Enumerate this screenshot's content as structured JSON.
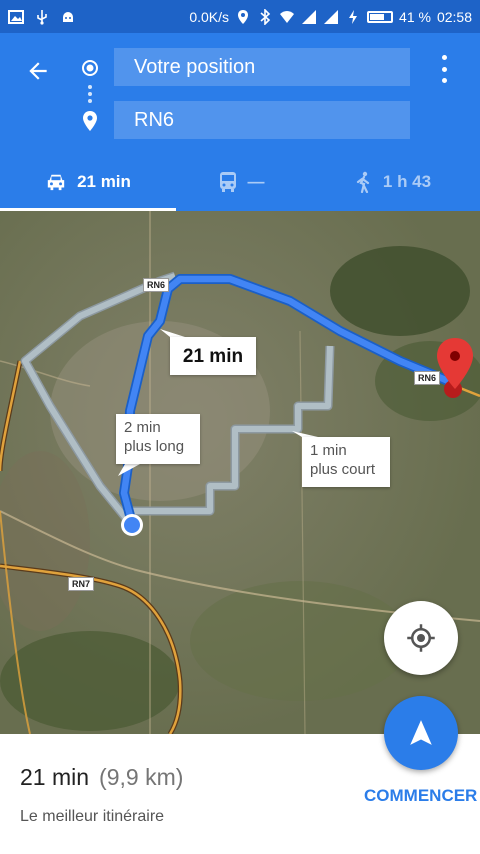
{
  "status_bar": {
    "speed": "0.0K/s",
    "battery": "41 %",
    "time": "02:58",
    "icons": [
      "image-icon",
      "usb-icon",
      "android-icon",
      "location-icon",
      "bluetooth-icon",
      "wifi-icon",
      "signal-icon",
      "signal-icon",
      "charging-icon",
      "battery-icon"
    ]
  },
  "header": {
    "origin": "Votre position",
    "destination": "RN6"
  },
  "tabs": [
    {
      "mode": "car-icon",
      "label": "21 min",
      "selected": true
    },
    {
      "mode": "transit-icon",
      "label": "—",
      "selected": false
    },
    {
      "mode": "walk-icon",
      "label": "1 h 43",
      "selected": false
    }
  ],
  "map": {
    "main_route_time": "21 min",
    "alt_route_1": {
      "line1": "2 min",
      "line2": "plus long"
    },
    "alt_route_2": {
      "line1": "1 min",
      "line2": "plus court"
    },
    "road_labels": [
      "RN6",
      "RN6",
      "RN7"
    ],
    "colors": {
      "route": "#4285f4",
      "alt_route": "#b0bec5",
      "pin": "#e53935"
    }
  },
  "summary": {
    "time": "21 min",
    "distance": "(9,9 km)",
    "description": "Le meilleur itinéraire",
    "start_label": "COMMENCER"
  },
  "colors": {
    "status_bar": "#1e63c7",
    "header": "#2b7de9",
    "accent": "#2b7de9"
  }
}
